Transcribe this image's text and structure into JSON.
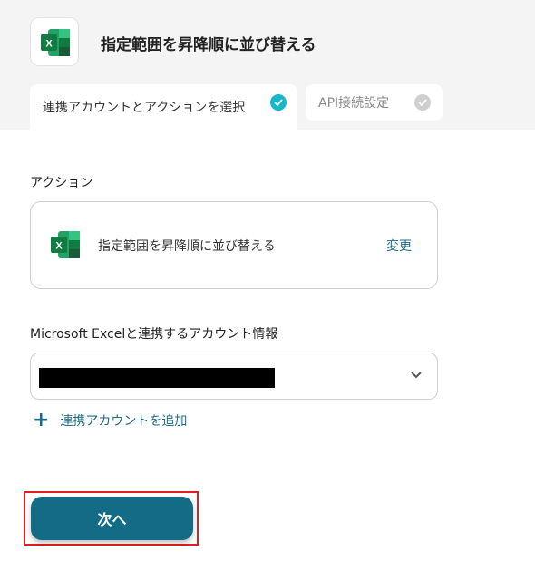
{
  "header": {
    "title": "指定範囲を昇降順に並び替える",
    "app_icon": "excel-icon"
  },
  "tabs": [
    {
      "label": "連携アカウントとアクションを選択",
      "state": "completed"
    },
    {
      "label": "API接続設定",
      "state": "pending"
    }
  ],
  "action_section": {
    "label": "アクション",
    "action_name": "指定範囲を昇降順に並び替える",
    "change_label": "変更"
  },
  "account_section": {
    "label": "Microsoft Excelと連携するアカウント情報",
    "selected_value_redacted": true,
    "add_account_label": "連携アカウントを追加"
  },
  "footer": {
    "next_label": "次へ"
  },
  "colors": {
    "accent": "#146b86",
    "link": "#1a6a86",
    "check_active": "#14b8c9",
    "check_inactive": "#cfcfcf",
    "highlight": "#e02020"
  }
}
